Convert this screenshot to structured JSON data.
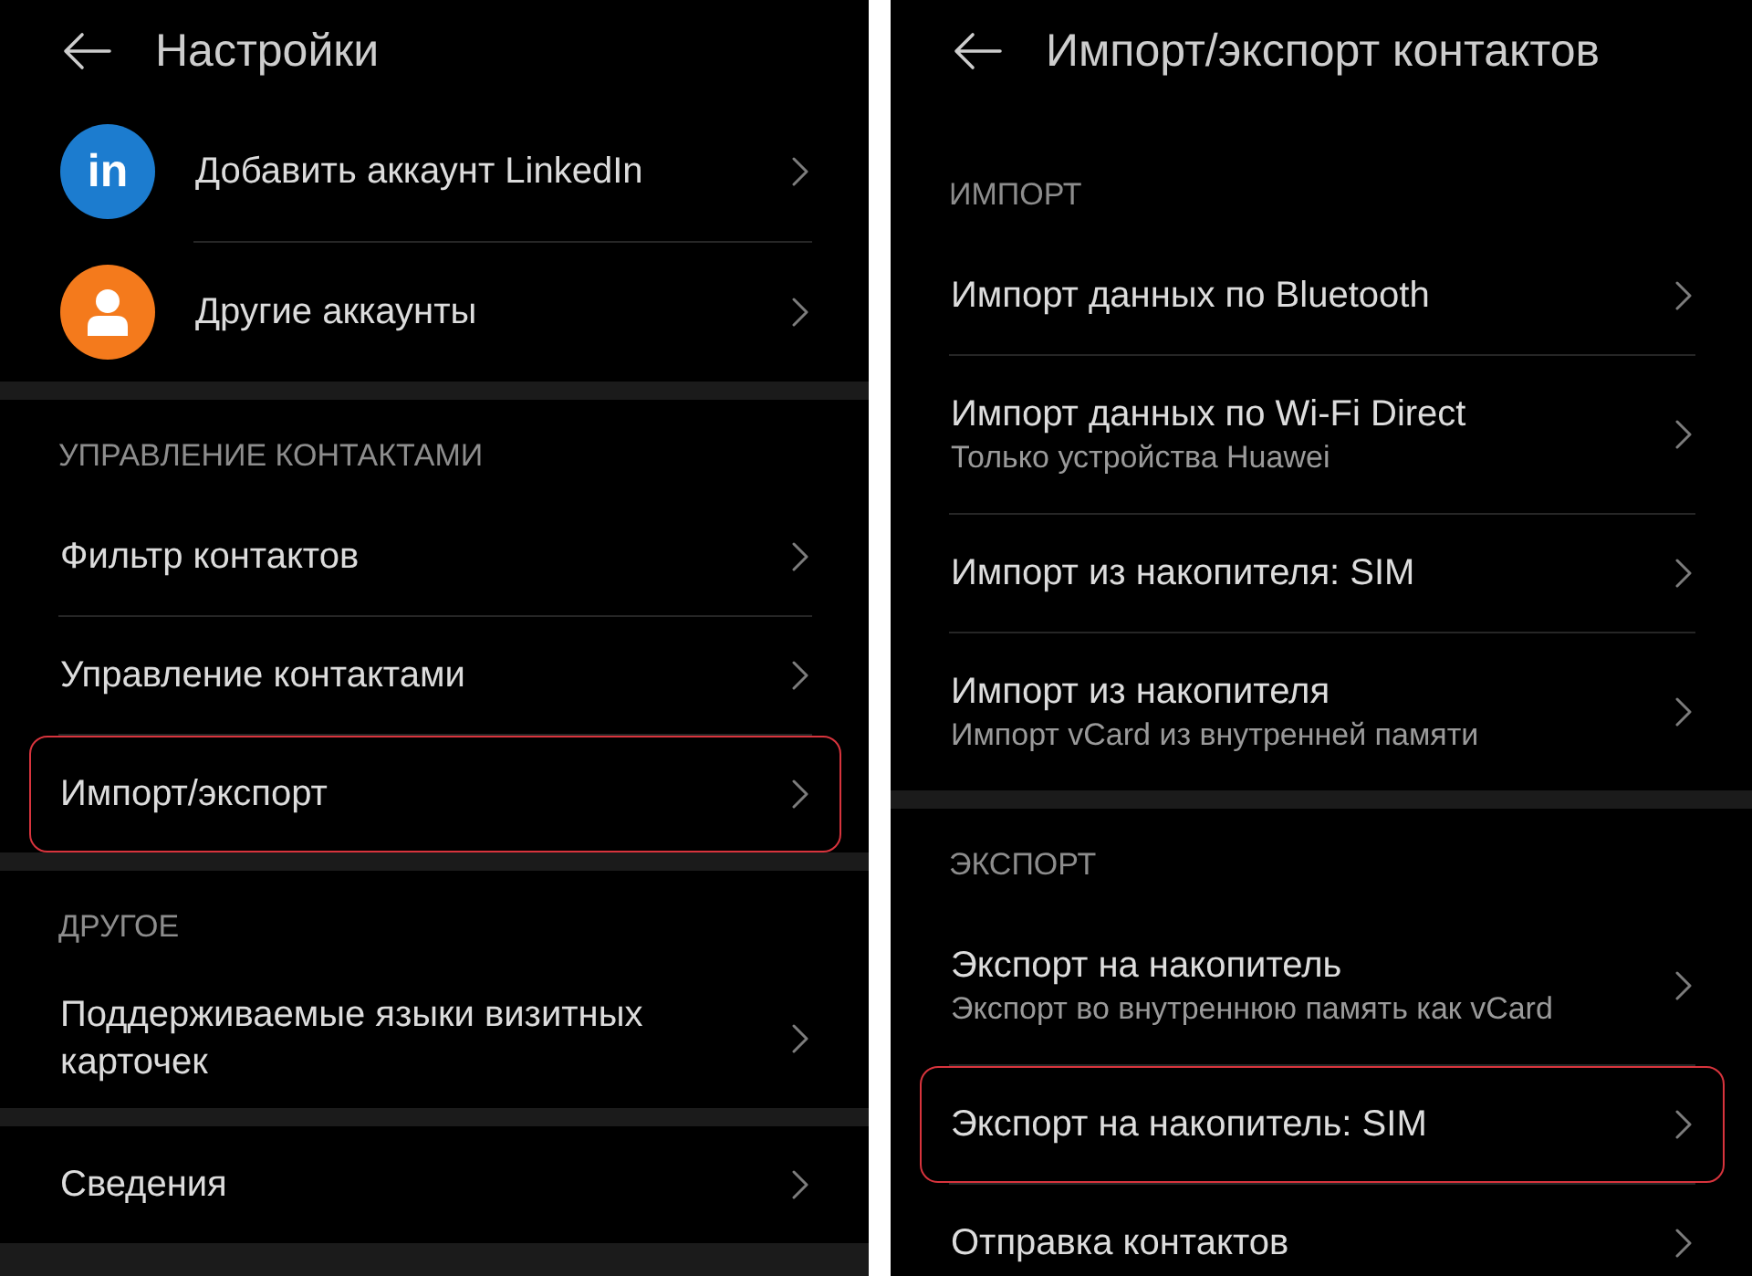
{
  "panels": [
    {
      "header": {
        "title": "Настройки"
      },
      "groups": [
        {
          "items": [
            {
              "kind": "account",
              "label": "Добавить аккаунт LinkedIn",
              "icon": {
                "kind": "letters",
                "text": "in",
                "color": "#1c7ccf"
              },
              "highlighted": false
            },
            {
              "kind": "account",
              "label": "Другие аккаунты",
              "icon": {
                "kind": "person",
                "color": "#f47a1c"
              },
              "highlighted": false
            }
          ]
        },
        {
          "heading": "УПРАВЛЕНИЕ КОНТАКТАМИ",
          "items": [
            {
              "kind": "plain",
              "label": "Фильтр контактов",
              "highlighted": false
            },
            {
              "kind": "plain",
              "label": "Управление контактами",
              "highlighted": false
            },
            {
              "kind": "plain",
              "label": "Импорт/экспорт",
              "highlighted": true
            }
          ]
        },
        {
          "heading": "ДРУГОЕ",
          "items": [
            {
              "kind": "plain",
              "label": "Поддерживаемые языки визитных карточек",
              "highlighted": false
            }
          ]
        },
        {
          "items": [
            {
              "kind": "plain",
              "label": "Сведения",
              "highlighted": false
            }
          ]
        }
      ]
    },
    {
      "header": {
        "title": "Импорт/экспорт контактов"
      },
      "groups": [
        {
          "heading": "ИМПОРТ",
          "items": [
            {
              "kind": "plain",
              "label": "Импорт данных по Bluetooth",
              "highlighted": false
            },
            {
              "kind": "plain",
              "label": "Импорт данных по Wi-Fi Direct",
              "description": "Только устройства Huawei",
              "highlighted": false
            },
            {
              "kind": "plain",
              "label": "Импорт из накопителя: SIM",
              "highlighted": false
            },
            {
              "kind": "plain",
              "label": "Импорт из накопителя",
              "description": "Импорт vCard из внутренней памяти",
              "highlighted": false
            }
          ]
        },
        {
          "heading": "ЭКСПОРТ",
          "items": [
            {
              "kind": "plain",
              "label": "Экспорт на накопитель",
              "description": "Экспорт во внутреннюю память как vCard",
              "highlighted": false
            },
            {
              "kind": "plain",
              "label": "Экспорт на накопитель: SIM",
              "highlighted": true
            },
            {
              "kind": "plain",
              "label": "Отправка контактов",
              "highlighted": false
            }
          ]
        }
      ]
    }
  ]
}
